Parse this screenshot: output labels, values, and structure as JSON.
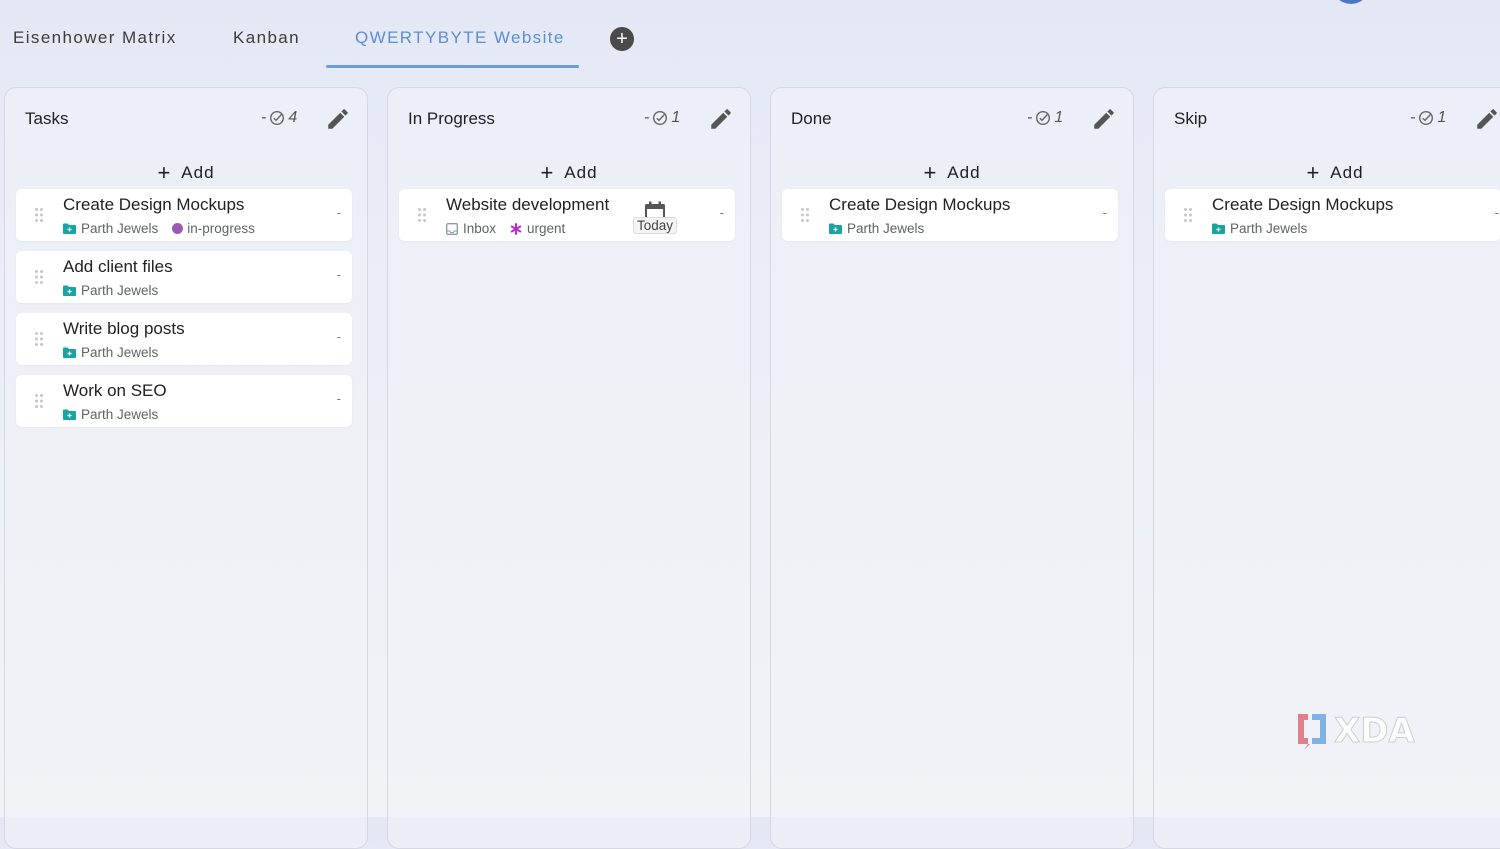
{
  "tabs": [
    {
      "label": "Eisenhower Matrix"
    },
    {
      "label": "Kanban"
    },
    {
      "label": "QWERTYBYTE Website"
    }
  ],
  "active_tab": "QWERTYBYTE Website",
  "add_label": "Add",
  "columns": [
    {
      "title": "Tasks",
      "count": "- ",
      "count_value": "4",
      "cards": [
        {
          "title": "Create Design Mockups",
          "project": "Parth Jewels",
          "tag": "in-progress",
          "more": "-"
        },
        {
          "title": "Add client files",
          "project": "Parth Jewels",
          "more": "-"
        },
        {
          "title": "Write blog posts",
          "project": "Parth Jewels",
          "more": "-"
        },
        {
          "title": "Work on SEO",
          "project": "Parth Jewels",
          "more": "-"
        }
      ]
    },
    {
      "title": "In Progress",
      "count": "- ",
      "count_value": "1",
      "cards": [
        {
          "title": "Website development",
          "project": "Inbox",
          "tag": "urgent",
          "due": "Today",
          "more": "-"
        }
      ]
    },
    {
      "title": "Done",
      "count": "- ",
      "count_value": "1",
      "cards": [
        {
          "title": "Create Design Mockups",
          "project": "Parth Jewels",
          "more": "-"
        }
      ]
    },
    {
      "title": "Skip",
      "count": "- ",
      "count_value": "1",
      "cards": [
        {
          "title": "Create Design Mockups",
          "project": "Parth Jewels",
          "more": "-"
        }
      ]
    }
  ],
  "watermark": "XDA",
  "colors": {
    "accent": "#5b8fd0",
    "project_icon": "#1aa3a3",
    "tag_in_progress": "#9b59b6",
    "tag_urgent": "#c026d3"
  },
  "icons": {
    "add_tab": "plus-circle-icon",
    "edit": "pencil-icon",
    "count": "check-circle-icon",
    "project": "folder-icon",
    "inbox": "inbox-icon",
    "urgent": "asterisk-icon",
    "due": "calendar-icon",
    "drag": "drag-handle-icon"
  }
}
